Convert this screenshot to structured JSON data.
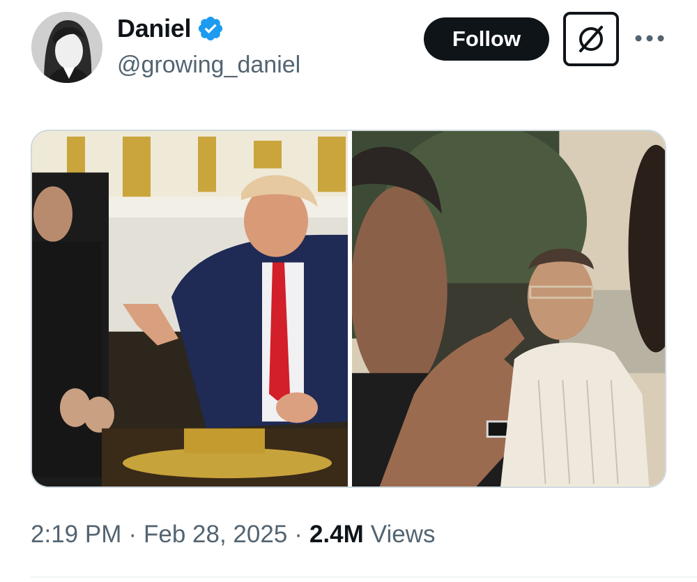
{
  "author": {
    "display_name": "Daniel",
    "handle": "@growing_daniel",
    "verified": true,
    "verified_color": "#1d9bf0",
    "avatar_icon": "profile-photo"
  },
  "actions": {
    "follow_label": "Follow",
    "grok_icon": "grok-icon",
    "more_icon": "more-icon"
  },
  "media": [
    {
      "kind": "photo",
      "position": "left",
      "icon": "image-oval-office-meeting"
    },
    {
      "kind": "photo",
      "position": "right",
      "icon": "image-film-still-pointing"
    }
  ],
  "meta": {
    "time": "2:19 PM",
    "separator": "·",
    "date": "Feb 28, 2025",
    "views_count": "2.4M",
    "views_label": "Views"
  },
  "colors": {
    "text_primary": "#0f1419",
    "text_secondary": "#536471",
    "button_bg": "#0f1419",
    "border": "#cfd9de"
  }
}
